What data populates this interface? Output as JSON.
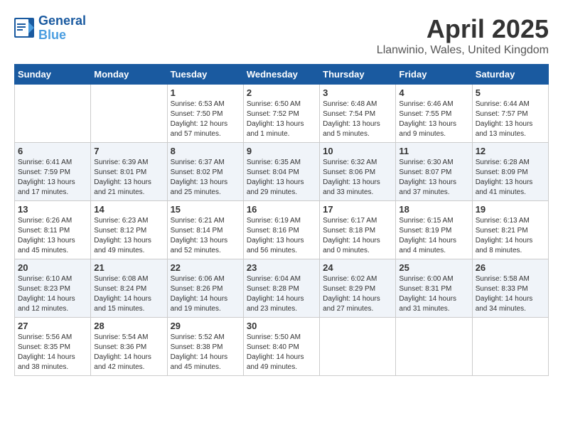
{
  "header": {
    "logo_line1": "General",
    "logo_line2": "Blue",
    "month_year": "April 2025",
    "location": "Llanwinio, Wales, United Kingdom"
  },
  "weekdays": [
    "Sunday",
    "Monday",
    "Tuesday",
    "Wednesday",
    "Thursday",
    "Friday",
    "Saturday"
  ],
  "weeks": [
    [
      {
        "day": "",
        "info": ""
      },
      {
        "day": "",
        "info": ""
      },
      {
        "day": "1",
        "info": "Sunrise: 6:53 AM\nSunset: 7:50 PM\nDaylight: 12 hours\nand 57 minutes."
      },
      {
        "day": "2",
        "info": "Sunrise: 6:50 AM\nSunset: 7:52 PM\nDaylight: 13 hours\nand 1 minute."
      },
      {
        "day": "3",
        "info": "Sunrise: 6:48 AM\nSunset: 7:54 PM\nDaylight: 13 hours\nand 5 minutes."
      },
      {
        "day": "4",
        "info": "Sunrise: 6:46 AM\nSunset: 7:55 PM\nDaylight: 13 hours\nand 9 minutes."
      },
      {
        "day": "5",
        "info": "Sunrise: 6:44 AM\nSunset: 7:57 PM\nDaylight: 13 hours\nand 13 minutes."
      }
    ],
    [
      {
        "day": "6",
        "info": "Sunrise: 6:41 AM\nSunset: 7:59 PM\nDaylight: 13 hours\nand 17 minutes."
      },
      {
        "day": "7",
        "info": "Sunrise: 6:39 AM\nSunset: 8:01 PM\nDaylight: 13 hours\nand 21 minutes."
      },
      {
        "day": "8",
        "info": "Sunrise: 6:37 AM\nSunset: 8:02 PM\nDaylight: 13 hours\nand 25 minutes."
      },
      {
        "day": "9",
        "info": "Sunrise: 6:35 AM\nSunset: 8:04 PM\nDaylight: 13 hours\nand 29 minutes."
      },
      {
        "day": "10",
        "info": "Sunrise: 6:32 AM\nSunset: 8:06 PM\nDaylight: 13 hours\nand 33 minutes."
      },
      {
        "day": "11",
        "info": "Sunrise: 6:30 AM\nSunset: 8:07 PM\nDaylight: 13 hours\nand 37 minutes."
      },
      {
        "day": "12",
        "info": "Sunrise: 6:28 AM\nSunset: 8:09 PM\nDaylight: 13 hours\nand 41 minutes."
      }
    ],
    [
      {
        "day": "13",
        "info": "Sunrise: 6:26 AM\nSunset: 8:11 PM\nDaylight: 13 hours\nand 45 minutes."
      },
      {
        "day": "14",
        "info": "Sunrise: 6:23 AM\nSunset: 8:12 PM\nDaylight: 13 hours\nand 49 minutes."
      },
      {
        "day": "15",
        "info": "Sunrise: 6:21 AM\nSunset: 8:14 PM\nDaylight: 13 hours\nand 52 minutes."
      },
      {
        "day": "16",
        "info": "Sunrise: 6:19 AM\nSunset: 8:16 PM\nDaylight: 13 hours\nand 56 minutes."
      },
      {
        "day": "17",
        "info": "Sunrise: 6:17 AM\nSunset: 8:18 PM\nDaylight: 14 hours\nand 0 minutes."
      },
      {
        "day": "18",
        "info": "Sunrise: 6:15 AM\nSunset: 8:19 PM\nDaylight: 14 hours\nand 4 minutes."
      },
      {
        "day": "19",
        "info": "Sunrise: 6:13 AM\nSunset: 8:21 PM\nDaylight: 14 hours\nand 8 minutes."
      }
    ],
    [
      {
        "day": "20",
        "info": "Sunrise: 6:10 AM\nSunset: 8:23 PM\nDaylight: 14 hours\nand 12 minutes."
      },
      {
        "day": "21",
        "info": "Sunrise: 6:08 AM\nSunset: 8:24 PM\nDaylight: 14 hours\nand 15 minutes."
      },
      {
        "day": "22",
        "info": "Sunrise: 6:06 AM\nSunset: 8:26 PM\nDaylight: 14 hours\nand 19 minutes."
      },
      {
        "day": "23",
        "info": "Sunrise: 6:04 AM\nSunset: 8:28 PM\nDaylight: 14 hours\nand 23 minutes."
      },
      {
        "day": "24",
        "info": "Sunrise: 6:02 AM\nSunset: 8:29 PM\nDaylight: 14 hours\nand 27 minutes."
      },
      {
        "day": "25",
        "info": "Sunrise: 6:00 AM\nSunset: 8:31 PM\nDaylight: 14 hours\nand 31 minutes."
      },
      {
        "day": "26",
        "info": "Sunrise: 5:58 AM\nSunset: 8:33 PM\nDaylight: 14 hours\nand 34 minutes."
      }
    ],
    [
      {
        "day": "27",
        "info": "Sunrise: 5:56 AM\nSunset: 8:35 PM\nDaylight: 14 hours\nand 38 minutes."
      },
      {
        "day": "28",
        "info": "Sunrise: 5:54 AM\nSunset: 8:36 PM\nDaylight: 14 hours\nand 42 minutes."
      },
      {
        "day": "29",
        "info": "Sunrise: 5:52 AM\nSunset: 8:38 PM\nDaylight: 14 hours\nand 45 minutes."
      },
      {
        "day": "30",
        "info": "Sunrise: 5:50 AM\nSunset: 8:40 PM\nDaylight: 14 hours\nand 49 minutes."
      },
      {
        "day": "",
        "info": ""
      },
      {
        "day": "",
        "info": ""
      },
      {
        "day": "",
        "info": ""
      }
    ]
  ]
}
